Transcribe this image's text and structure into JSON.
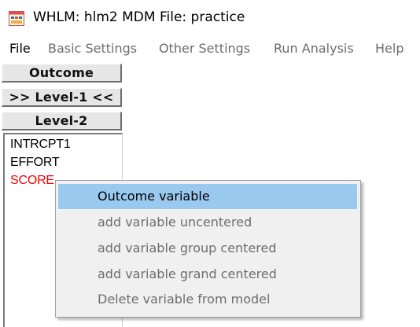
{
  "window": {
    "title": "WHLM: hlm2 MDM File: practice",
    "icon": "whlm-app-icon"
  },
  "menubar": {
    "items": [
      {
        "label": "File",
        "enabled": true
      },
      {
        "label": "Basic Settings",
        "enabled": false
      },
      {
        "label": "Other Settings",
        "enabled": false
      },
      {
        "label": "Run Analysis",
        "enabled": false
      },
      {
        "label": "Help",
        "enabled": false
      }
    ]
  },
  "left_panel": {
    "buttons": [
      {
        "label": "Outcome"
      },
      {
        "label": ">> Level-1 <<"
      },
      {
        "label": "Level-2"
      }
    ],
    "variables": [
      {
        "label": "INTRCPT1",
        "color": "#000000"
      },
      {
        "label": "EFFORT",
        "color": "#000000"
      },
      {
        "label": "SCORE",
        "color": "#ff0000"
      }
    ]
  },
  "context_menu": {
    "items": [
      {
        "label": "Outcome variable",
        "highlighted": true,
        "enabled": true
      },
      {
        "label": "add variable uncentered",
        "enabled": false
      },
      {
        "label": "add variable group centered",
        "enabled": false
      },
      {
        "label": "add variable grand centered",
        "enabled": false
      },
      {
        "label": "Delete variable from model",
        "enabled": false
      }
    ]
  },
  "colors": {
    "highlight": "#99c9ef",
    "disabled_text": "#6d6d6d",
    "button_face": "#e6e6e6"
  }
}
